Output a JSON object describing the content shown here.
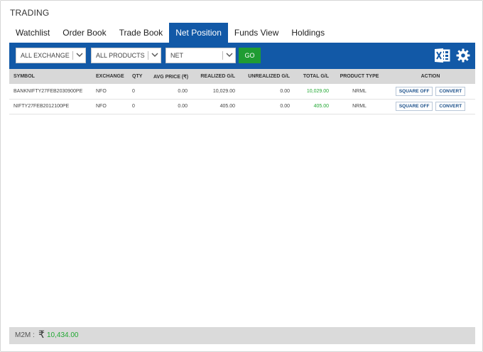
{
  "app": {
    "title": "TRADING"
  },
  "tabs": [
    {
      "label": "Watchlist",
      "active": false
    },
    {
      "label": "Order Book",
      "active": false
    },
    {
      "label": "Trade Book",
      "active": false
    },
    {
      "label": "Net Position",
      "active": true
    },
    {
      "label": "Funds View",
      "active": false
    },
    {
      "label": "Holdings",
      "active": false
    }
  ],
  "filters": {
    "exchange": "ALL EXCHANGE",
    "products": "ALL PRODUCTS",
    "view": "NET",
    "go_label": "GO"
  },
  "icons": {
    "export": "excel-icon",
    "settings": "gear-icon"
  },
  "table": {
    "headers": {
      "symbol": "SYMBOL",
      "exchange": "EXCHANGE",
      "qty": "QTY",
      "avg_price": "AVG PRICE (₹)",
      "realized": "REALIZED G/L",
      "unrealized": "UNREALIZED G/L",
      "total": "TOTAL G/L",
      "product_type": "PRODUCT TYPE",
      "action": "ACTION"
    },
    "rows": [
      {
        "symbol": "BANKNIFTY27FEB2030900PE",
        "exchange": "NFO",
        "qty": "0",
        "avg_price": "0.00",
        "realized": "10,029.00",
        "unrealized": "0.00",
        "total": "10,029.00",
        "product_type": "NRML",
        "square_off": "SQUARE OFF",
        "convert": "CONVERT"
      },
      {
        "symbol": "NIFTY27FEB2012100PE",
        "exchange": "NFO",
        "qty": "0",
        "avg_price": "0.00",
        "realized": "405.00",
        "unrealized": "0.00",
        "total": "405.00",
        "product_type": "NRML",
        "square_off": "SQUARE OFF",
        "convert": "CONVERT"
      }
    ]
  },
  "footer": {
    "label": "M2M :",
    "currency": "₹",
    "value": "10,434.00"
  },
  "colors": {
    "primary": "#1259a7",
    "positive": "#22a833",
    "go": "#1f9c33",
    "header_bg": "#d8d8d8"
  }
}
